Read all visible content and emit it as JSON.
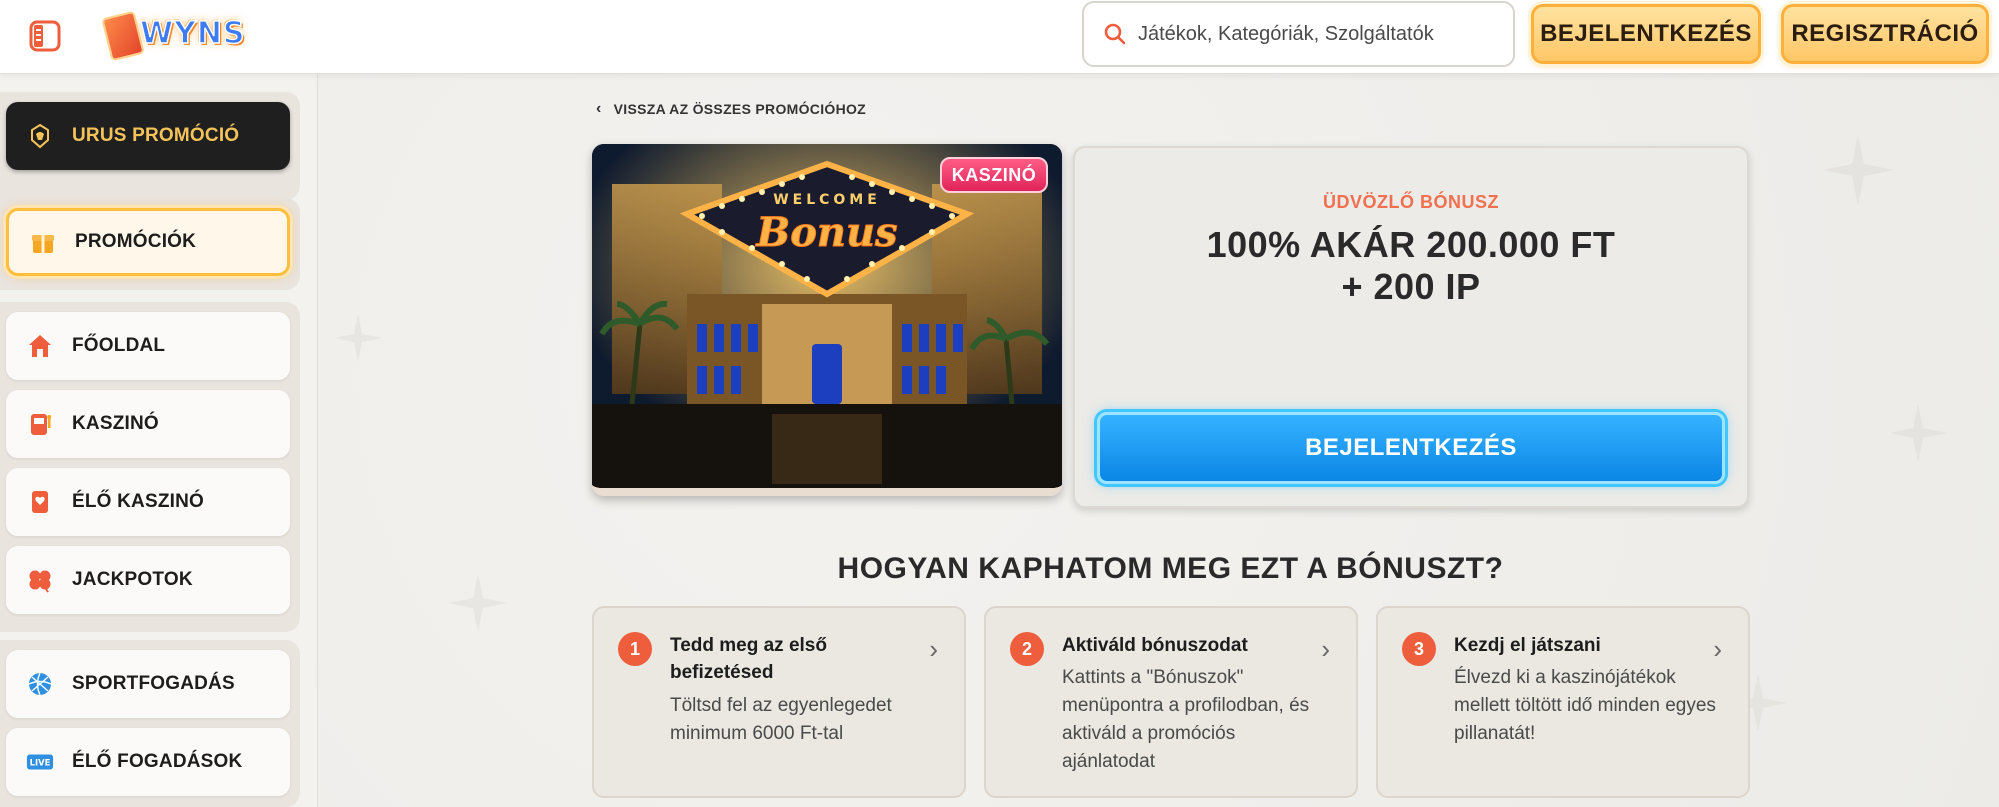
{
  "header": {
    "logo_text": "WYNS",
    "search_placeholder": "Játékok, Kategóriák, Szolgáltatók",
    "login_label": "BEJELENTKEZÉS",
    "register_label": "REGISZTRÁCIÓ"
  },
  "sidebar": {
    "items": [
      {
        "label": "URUS PROMÓCIÓ"
      },
      {
        "label": "PROMÓCIÓK"
      },
      {
        "label": "FŐOLDAL"
      },
      {
        "label": "KASZINÓ"
      },
      {
        "label": "ÉLŐ KASZINÓ"
      },
      {
        "label": "JACKPOTOK"
      },
      {
        "label": "SPORTFOGADÁS"
      },
      {
        "label": "ÉLŐ FOGADÁSOK"
      }
    ]
  },
  "main": {
    "back_label": "VISSZA AZ ÖSSZES PROMÓCIÓHOZ",
    "badge": "KASZINÓ",
    "image_sign": "WELCOME",
    "image_bonus": "Bonus",
    "bonus_type": "ÜDVÖZLŐ BÓNUSZ",
    "bonus_title_line1": "100% AKÁR 200.000 FT",
    "bonus_title_line2": "+ 200 IP",
    "login_button": "BEJELENTKEZÉS",
    "how_title": "HOGYAN KAPHATOM MEG EZT A BÓNUSZT?",
    "steps": [
      {
        "num": "1",
        "title": "Tedd meg az első befizetésed",
        "desc": "Töltsd fel az egyenlegedet minimum 6000 Ft-tal"
      },
      {
        "num": "2",
        "title": "Aktiváld bónuszodat",
        "desc": "Kattints a \"Bónuszok\" menüpontra a profilodban, és aktiváld a promóciós ajánlatodat"
      },
      {
        "num": "3",
        "title": "Kezdj el játszani",
        "desc": "Élvezd ki a kaszinójátékok mellett töltött idő minden egyes pillanatát!"
      }
    ]
  },
  "colors": {
    "accent_orange": "#ee5d3c",
    "button_blue": "#0a86e6",
    "gold": "#ffc766"
  }
}
